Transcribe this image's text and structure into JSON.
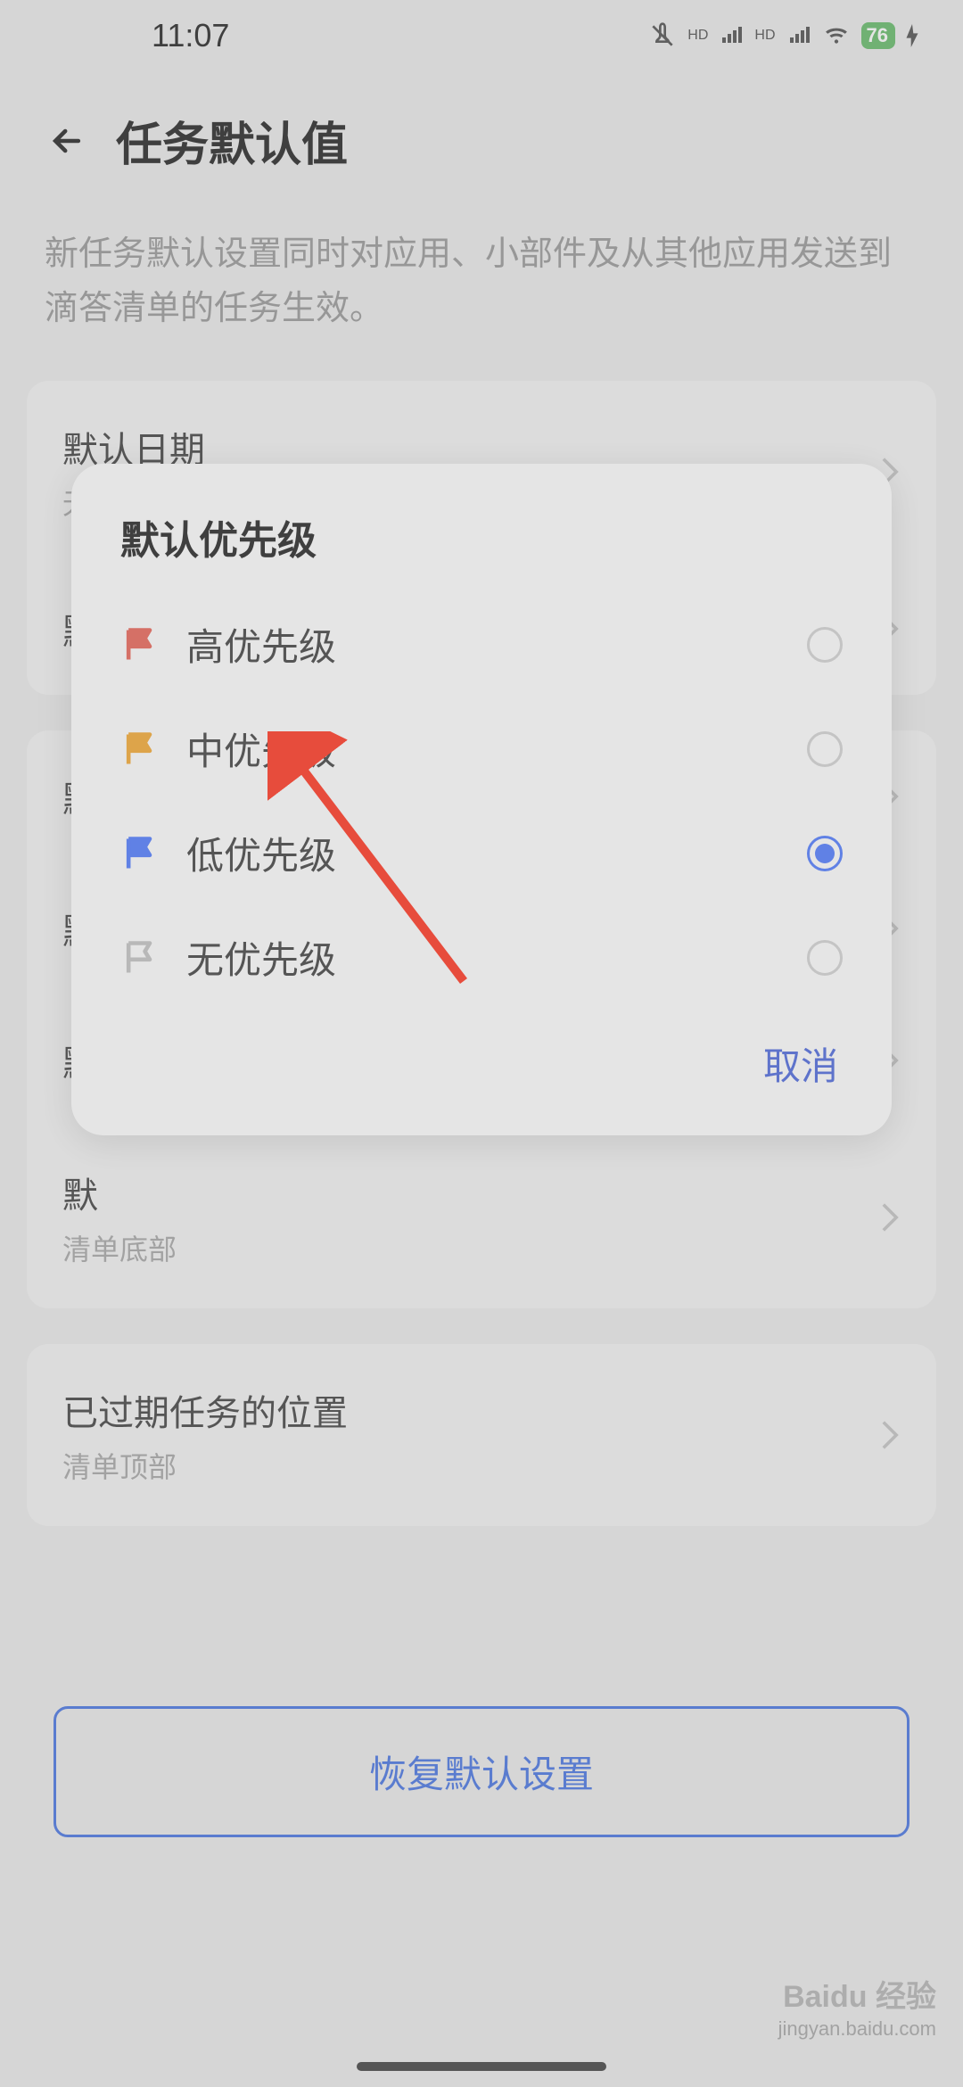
{
  "status": {
    "time": "11:07",
    "battery": "76"
  },
  "header": {
    "title": "任务默认值"
  },
  "description": "新任务默认设置同时对应用、小部件及从其他应用发送到滴答清单的任务生效。",
  "settings": {
    "defaultDate": {
      "label": "默认日期",
      "value": "无"
    },
    "defaultReminder": {
      "label": "默认提醒"
    },
    "item3": {
      "label": "默",
      "value": ""
    },
    "item4": {
      "label": "默",
      "value": ""
    },
    "item5": {
      "label": "默",
      "value": ""
    },
    "item6": {
      "label": "默",
      "value": "清单底部"
    },
    "expired": {
      "label": "已过期任务的位置",
      "value": "清单顶部"
    }
  },
  "restoreButton": "恢复默认设置",
  "dialog": {
    "title": "默认优先级",
    "options": [
      {
        "label": "高优先级",
        "color": "#e74c3c",
        "selected": false
      },
      {
        "label": "中优先级",
        "color": "#f39c12",
        "selected": false
      },
      {
        "label": "低优先级",
        "color": "#3366ff",
        "selected": true
      },
      {
        "label": "无优先级",
        "color": "none",
        "selected": false
      }
    ],
    "cancel": "取消"
  },
  "watermark": {
    "brand": "Baidu 经验",
    "url": "jingyan.baidu.com"
  }
}
